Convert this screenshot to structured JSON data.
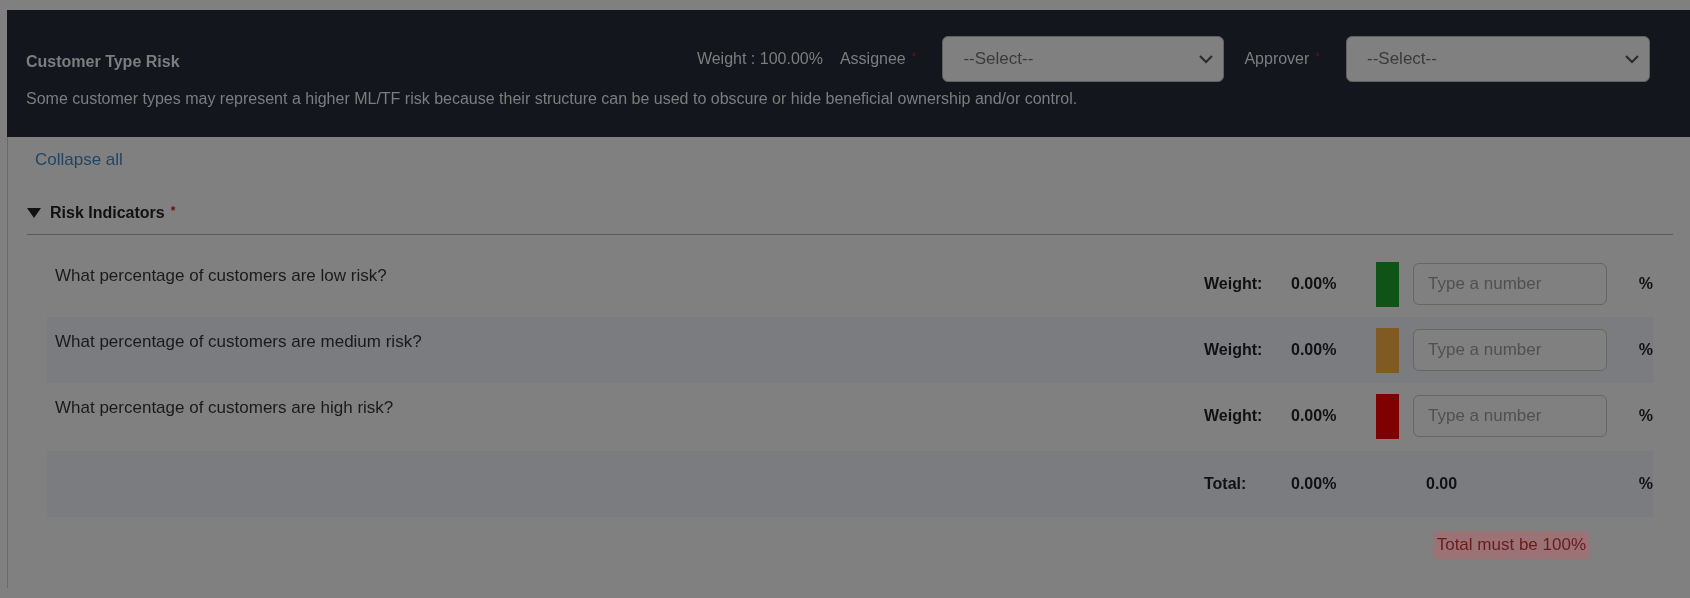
{
  "header": {
    "title": "Customer Type Risk",
    "weight": "Weight : 100.00%",
    "fields": [
      {
        "label": "Assignee",
        "required_mark": "*",
        "value": "--Select--"
      },
      {
        "label": "Approver",
        "required_mark": "*",
        "value": "--Select--"
      }
    ],
    "description": "Some customer types may represent a higher ML/TF risk because their structure can be used to obscure or hide beneficial ownership and/or control."
  },
  "collapse_link": "Collapse all",
  "section": {
    "title": "Risk Indicators",
    "required_mark": "*",
    "expanded": true,
    "rows": [
      {
        "question": "What percentage of customers are low risk?",
        "weight_label": "Weight:",
        "weight": "0.00%",
        "color": "#0f5416",
        "placeholder": "Type a number",
        "unit": "%"
      },
      {
        "question": "What percentage of customers are medium risk?",
        "weight_label": "Weight:",
        "weight": "0.00%",
        "color": "#7f5a22",
        "placeholder": "Type a number",
        "unit": "%"
      },
      {
        "question": "What percentage of customers are high risk?",
        "weight_label": "Weight:",
        "weight": "0.00%",
        "color": "#7f0000",
        "placeholder": "Type a number",
        "unit": "%"
      }
    ],
    "total": {
      "label": "Total:",
      "weight": "0.00%",
      "value": "0.00",
      "unit": "%"
    },
    "error": "Total must be 100%"
  }
}
